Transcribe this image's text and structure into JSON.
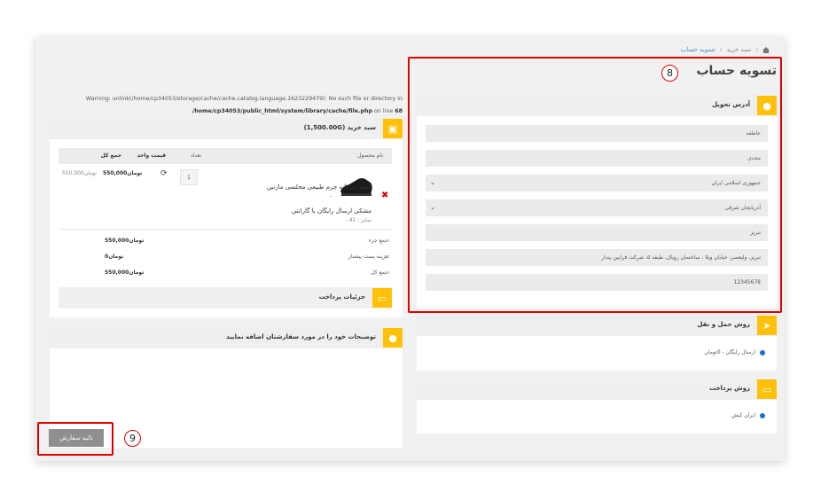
{
  "breadcrumb": {
    "items": [
      "سبد خرید",
      "تسویه حساب"
    ]
  },
  "page": {
    "title": "تسویه حساب"
  },
  "warning": {
    "line1": "Warning: unlink(/home/cp34053/storage/cache/cache.catalog.language.1623229479): No such file or directory in",
    "line2a": "/home/cp34053/public_html/system/library/cache/file.php",
    "line2b": "on line",
    "line2c": "68"
  },
  "delivery": {
    "title": "آدرس تحویل",
    "fields": {
      "first_name": "عاطفه",
      "last_name": "مجدی",
      "country": "جمهوری اسلامی ایران",
      "zone": "آذربایجان شرقی",
      "city": "تبریز",
      "address": "تبریز، ولیعصر، خیابان ویلا ، ساختمان رویال، طبقه ۵، شرکت فرابین پندار",
      "postcode": "12345678"
    }
  },
  "shipping": {
    "title": "روش حمل و نقل",
    "option": "ارسال رایگان - 0تومان"
  },
  "payment": {
    "title": "روش پرداخت",
    "option": "ایران کیش"
  },
  "cart": {
    "title": "سبد خرید (1,500.00G)",
    "headers": {
      "name": "نام محصول",
      "qty": "تعداد",
      "unit_price": "قیمت واحد",
      "total": "جمع کل"
    },
    "item": {
      "name": "کفش مردانه چرم طبیعی مجلسی مارتین",
      "name_cont": "مشکی ارسال رایگان با گارانتی",
      "option": "- سایز : 41",
      "dash": "-",
      "qty": "1",
      "unit_price": "550,000تومان",
      "total": "550,000تومان"
    },
    "totals": [
      {
        "label": "جمع جزء:",
        "value": "550,000تومان"
      },
      {
        "label": "هزینه پست پیشتاز:",
        "value": "0تومان"
      },
      {
        "label": "جمع کل:",
        "value": "550,000تومان"
      }
    ],
    "payment_details": "جزئیات پرداخت"
  },
  "comments": {
    "title": "توضیحات خود را در مورد سفارشتان اضافه نمایید"
  },
  "confirm": {
    "label": "تائید سفارش"
  },
  "annotations": {
    "badge8": "8",
    "badge9": "9"
  },
  "colors": {
    "accent": "#ffc107",
    "highlight": "#e00000",
    "link": "#4a8fc9"
  },
  "icons": [
    "home-icon",
    "bell-icon",
    "cart-icon",
    "card-icon",
    "comment-icon",
    "send-icon",
    "refresh-icon",
    "remove-icon",
    "chevron-down-icon"
  ]
}
